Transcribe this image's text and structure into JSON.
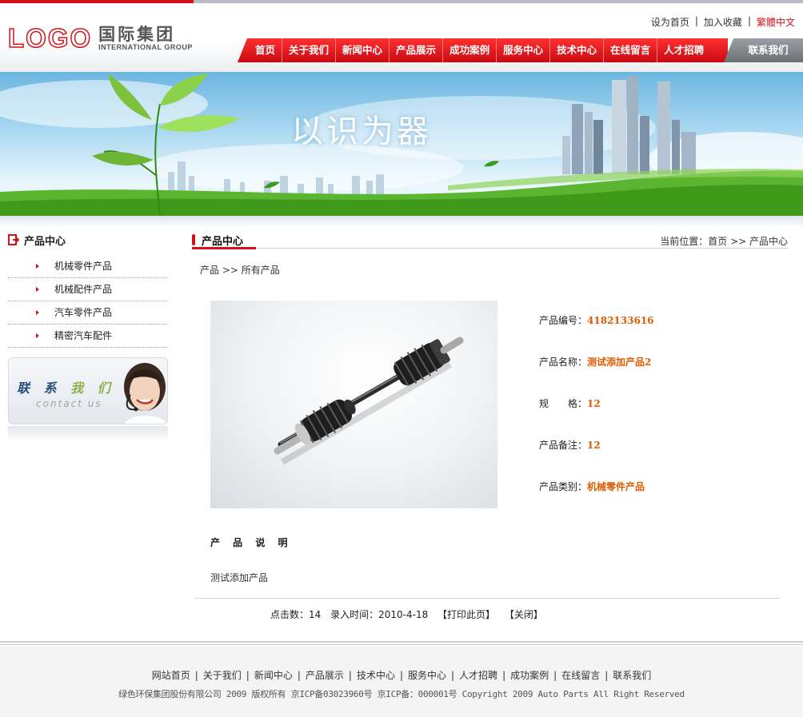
{
  "header": {
    "logo_mark": "LOGO",
    "logo_cn": "国际集团",
    "logo_en": "INTERNATIONAL GROUP",
    "toplinks": {
      "set_home": "设为首页",
      "add_fav": "加入收藏",
      "traditional": "繁體中文",
      "sep": "|"
    },
    "nav": [
      "首页",
      "关于我们",
      "新闻中心",
      "产品展示",
      "成功案例",
      "服务中心",
      "技术中心",
      "在线留言",
      "人才招聘"
    ],
    "nav_contact": "联系我们"
  },
  "banner": {
    "slogan": "以识为器"
  },
  "sidebar": {
    "title": "产品中心",
    "items": [
      {
        "label": "机械零件产品"
      },
      {
        "label": "机械配件产品"
      },
      {
        "label": "汽车零件产品"
      },
      {
        "label": "精密汽车配件"
      }
    ],
    "contact_cn_1": "联 系 ",
    "contact_cn_2": "我 们",
    "contact_en": "contact us"
  },
  "main": {
    "tab_title": "产品中心",
    "location": "当前位置：首页 >> 产品中心",
    "sub_crumb": "产品 >> 所有产品",
    "props": [
      {
        "label": "产品编号：",
        "value": "4182133616"
      },
      {
        "label": "产品名称：",
        "value": "测试添加产品2"
      },
      {
        "label": "规　　格：",
        "value": "12"
      },
      {
        "label": "产品备注：",
        "value": "12"
      },
      {
        "label": "产品类别：",
        "value": "机械零件产品"
      }
    ],
    "desc_title": "产 品 说 明",
    "desc_body": "测试添加产品",
    "meta": {
      "clicks": "点击数：14",
      "date": "录入时间：2010-4-18",
      "print": "【打印此页】",
      "close": "【关闭】"
    }
  },
  "footer": {
    "nav": [
      "网站首页",
      "关于我们",
      "新闻中心",
      "产品展示",
      "技术中心",
      "服务中心",
      "人才招聘",
      "成功案例",
      "在线留言",
      "联系我们"
    ],
    "sep": "|",
    "copyright": "绿色环保集团股份有限公司 2009 版权所有 京ICP备03023960号 京ICP备：000001号 Copyright 2009 Auto Parts All Right Reserved"
  },
  "colors": {
    "brand_red": "#d5121b",
    "value_orange": "#e05a00",
    "nav_gray": "#6b7076"
  }
}
